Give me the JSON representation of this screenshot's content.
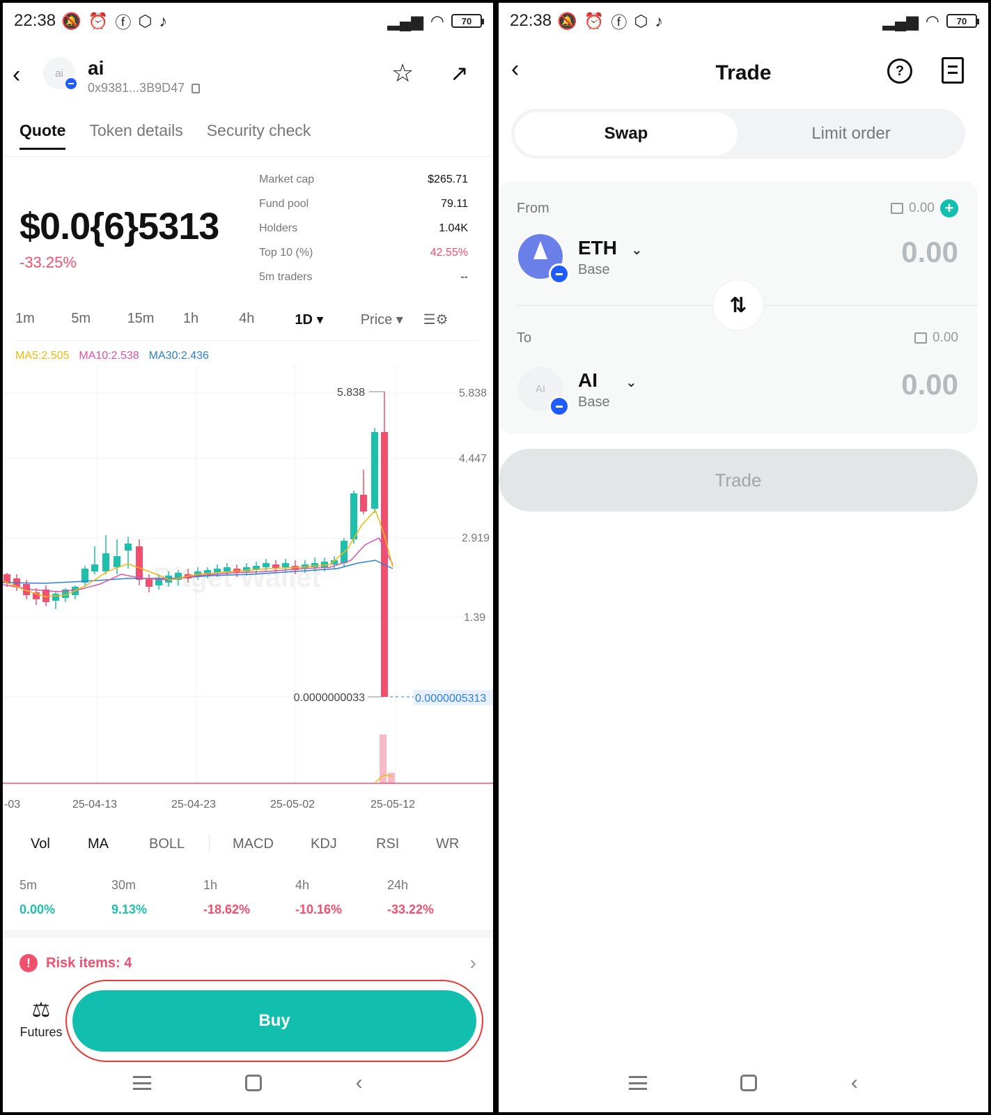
{
  "status_bar": {
    "time": "22:38",
    "battery": "70"
  },
  "left": {
    "token": {
      "avatar_text": "ai",
      "name": "ai",
      "address": "0x9381...3B9D47"
    },
    "tabs": [
      "Quote",
      "Token details",
      "Security check"
    ],
    "price": "$0.0{6}5313",
    "change": "-33.25%",
    "stats": [
      {
        "label": "Market cap",
        "value": "$265.71"
      },
      {
        "label": "Fund pool",
        "value": "79.11"
      },
      {
        "label": "Holders",
        "value": "1.04K"
      },
      {
        "label": "Top 10 (%)",
        "value": "42.55%"
      },
      {
        "label": "5m traders",
        "value": "--"
      }
    ],
    "intervals": [
      "1m",
      "5m",
      "15m",
      "1h",
      "4h",
      "1D ▾",
      "Price ▾"
    ],
    "ma_legend": {
      "ma5": "MA5:2.505",
      "ma10": "MA10:2.538",
      "ma30": "MA30:2.436"
    },
    "indicators": [
      "Vol",
      "MA",
      "BOLL",
      "MACD",
      "KDJ",
      "RSI",
      "WR"
    ],
    "performance": [
      {
        "label": "5m",
        "value": "0.00%"
      },
      {
        "label": "30m",
        "value": "9.13%"
      },
      {
        "label": "1h",
        "value": "-18.62%"
      },
      {
        "label": "4h",
        "value": "-10.16%"
      },
      {
        "label": "24h",
        "value": "-33.22%"
      }
    ],
    "risk": "Risk items: 4",
    "futures": "Futures",
    "buy": "Buy"
  },
  "chart_data": {
    "type": "candlestick",
    "y_ticks": [
      "5.838",
      "4.447",
      "2.919",
      "1.39"
    ],
    "high_label": "5.838",
    "low_label": "0.0000000033",
    "last_price_label": "0.0000005313",
    "x_ticks": [
      "-03",
      "25-04-13",
      "25-04-23",
      "25-05-02",
      "25-05-12"
    ],
    "watermark": "Bitget Wallet"
  },
  "right": {
    "title": "Trade",
    "segments": [
      "Swap",
      "Limit order"
    ],
    "from": {
      "label": "From",
      "balance": "0.00",
      "symbol": "ETH",
      "network": "Base",
      "amount": "0.00"
    },
    "to": {
      "label": "To",
      "balance": "0.00",
      "avatar_text": "AI",
      "symbol": "AI",
      "network": "Base",
      "amount": "0.00"
    },
    "trade_button": "Trade"
  },
  "colors": {
    "up": "#1fbfae",
    "down": "#f0506e",
    "ma5": "#f2b90d",
    "ma10": "#e14fa7",
    "ma30": "#2d7fd1",
    "accent": "#12bfae"
  }
}
